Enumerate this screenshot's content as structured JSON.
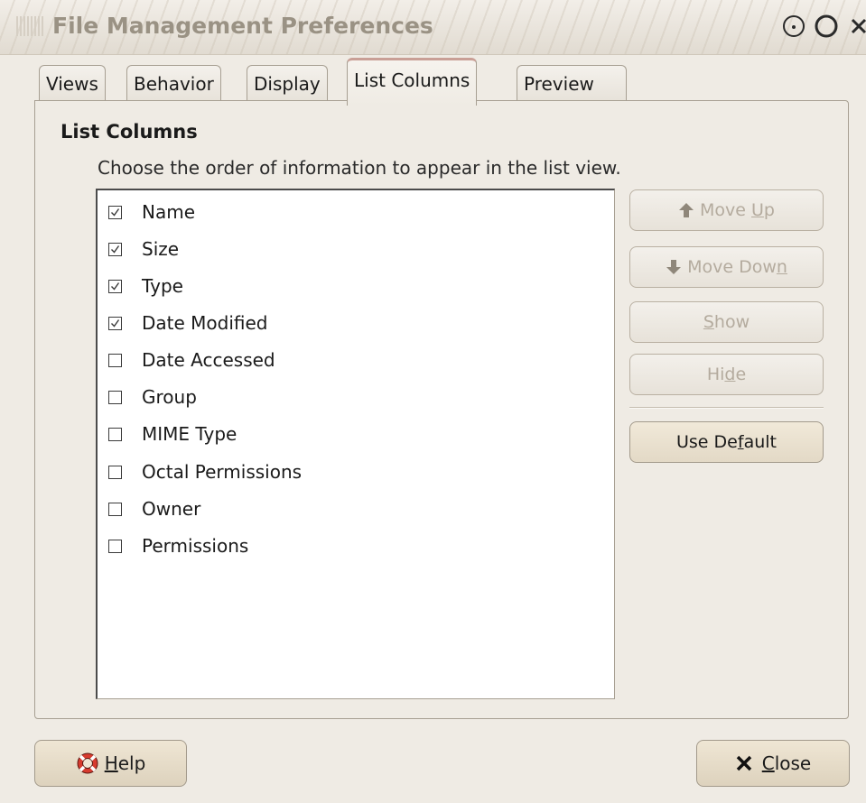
{
  "window": {
    "title": "File Management Preferences"
  },
  "tabs": [
    {
      "label": "Views"
    },
    {
      "label": "Behavior"
    },
    {
      "label": "Display"
    },
    {
      "label": "List Columns"
    },
    {
      "label": "Preview"
    }
  ],
  "active_tab": "List Columns",
  "section": {
    "title": "List Columns",
    "description": "Choose the order of information to appear in the list view."
  },
  "columns": [
    {
      "label": "Name",
      "checked": true
    },
    {
      "label": "Size",
      "checked": true
    },
    {
      "label": "Type",
      "checked": true
    },
    {
      "label": "Date Modified",
      "checked": true
    },
    {
      "label": "Date Accessed",
      "checked": false
    },
    {
      "label": "Group",
      "checked": false
    },
    {
      "label": "MIME Type",
      "checked": false
    },
    {
      "label": "Octal Permissions",
      "checked": false
    },
    {
      "label": "Owner",
      "checked": false
    },
    {
      "label": "Permissions",
      "checked": false
    }
  ],
  "buttons": {
    "move_up": {
      "pre": "Move ",
      "mnemonic": "U",
      "post": "p",
      "icon": "arrow-up-icon",
      "enabled": false
    },
    "move_down": {
      "pre": "Move Dow",
      "mnemonic": "n",
      "post": "",
      "icon": "arrow-down-icon",
      "enabled": false
    },
    "show": {
      "pre": "",
      "mnemonic": "S",
      "post": "how",
      "enabled": false
    },
    "hide": {
      "pre": "Hi",
      "mnemonic": "d",
      "post": "e",
      "enabled": false
    },
    "use_default": {
      "pre": "Use De",
      "mnemonic": "f",
      "post": "ault",
      "enabled": true
    },
    "help": {
      "pre": "",
      "mnemonic": "H",
      "post": "elp",
      "icon": "lifebuoy-icon"
    },
    "close": {
      "pre": "",
      "mnemonic": "C",
      "post": "lose",
      "icon": "close-x-icon"
    }
  },
  "colors": {
    "window_bg": "#efebe4",
    "active_tab_accent": "#c99f96",
    "disabled_text": "#b4ab9e"
  }
}
